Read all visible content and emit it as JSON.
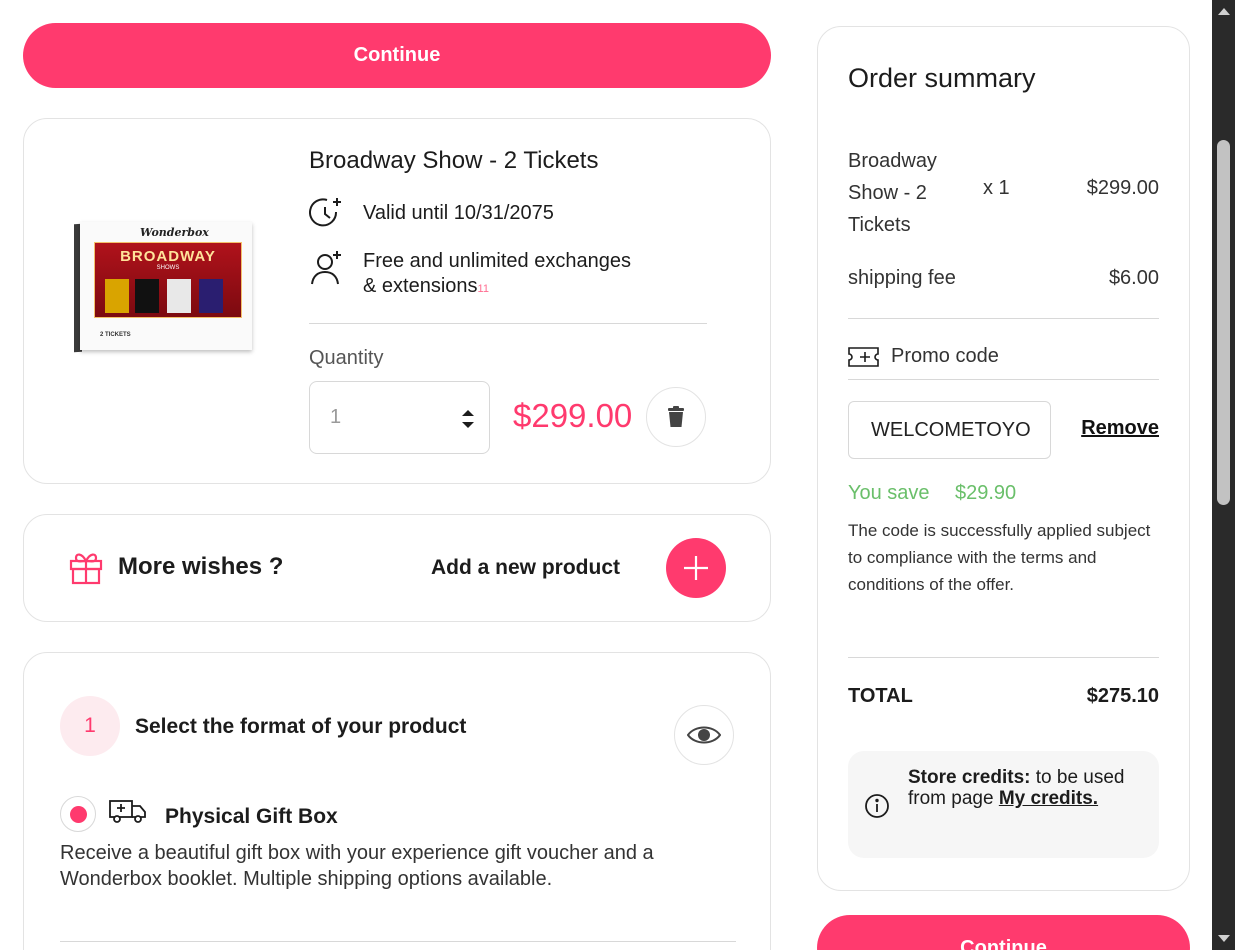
{
  "actions": {
    "continue_label": "Continue"
  },
  "product": {
    "title": "Broadway Show - 2 Tickets",
    "image": {
      "brand": "Wonderbox",
      "banner_title": "BROADWAY",
      "banner_sub": "SHOWS",
      "footer": "2 TICKETS"
    },
    "valid_until": "Valid until 10/31/2075",
    "exchanges_line1": "Free and unlimited exchanges",
    "exchanges_line2": "& extensions",
    "exchanges_note": "11",
    "quantity_label": "Quantity",
    "quantity_value": "1",
    "price": "$299.00"
  },
  "wishes": {
    "title": "More wishes ?",
    "add_label": "Add a new product"
  },
  "format": {
    "step_number": "1",
    "step_title": "Select the format of your product",
    "option_title": "Physical Gift Box",
    "option_desc": "Receive a beautiful gift box with your experience gift voucher and a Wonderbox booklet. Multiple shipping options available.",
    "selected": true
  },
  "summary": {
    "title": "Order summary",
    "item_name": "Broadway Show - 2 Tickets",
    "item_qty": "x 1",
    "item_price": "$299.00",
    "shipping_label": "shipping fee",
    "shipping_value": "$6.00",
    "promo_label": "Promo code",
    "promo_value": "WELCOMETOYO",
    "remove_label": "Remove",
    "save_label": "You save",
    "save_value": "$29.90",
    "applied_msg": "The code is successfully applied subject to compliance with the terms and conditions of the offer.",
    "total_label": "TOTAL",
    "total_value": "$275.10",
    "credits_bold": "Store credits:",
    "credits_text": " to be used from page ",
    "credits_link": "My credits."
  },
  "colors": {
    "accent": "#ff3a6e",
    "success": "#6abf6a",
    "accent_soft": "#fdebef"
  },
  "icons": [
    "clock-plus-icon",
    "user-plus-icon",
    "chevron-updown-icon",
    "trash-icon",
    "gift-icon",
    "plus-icon",
    "eye-icon",
    "truck-icon",
    "ticket-percent-icon",
    "info-icon"
  ]
}
